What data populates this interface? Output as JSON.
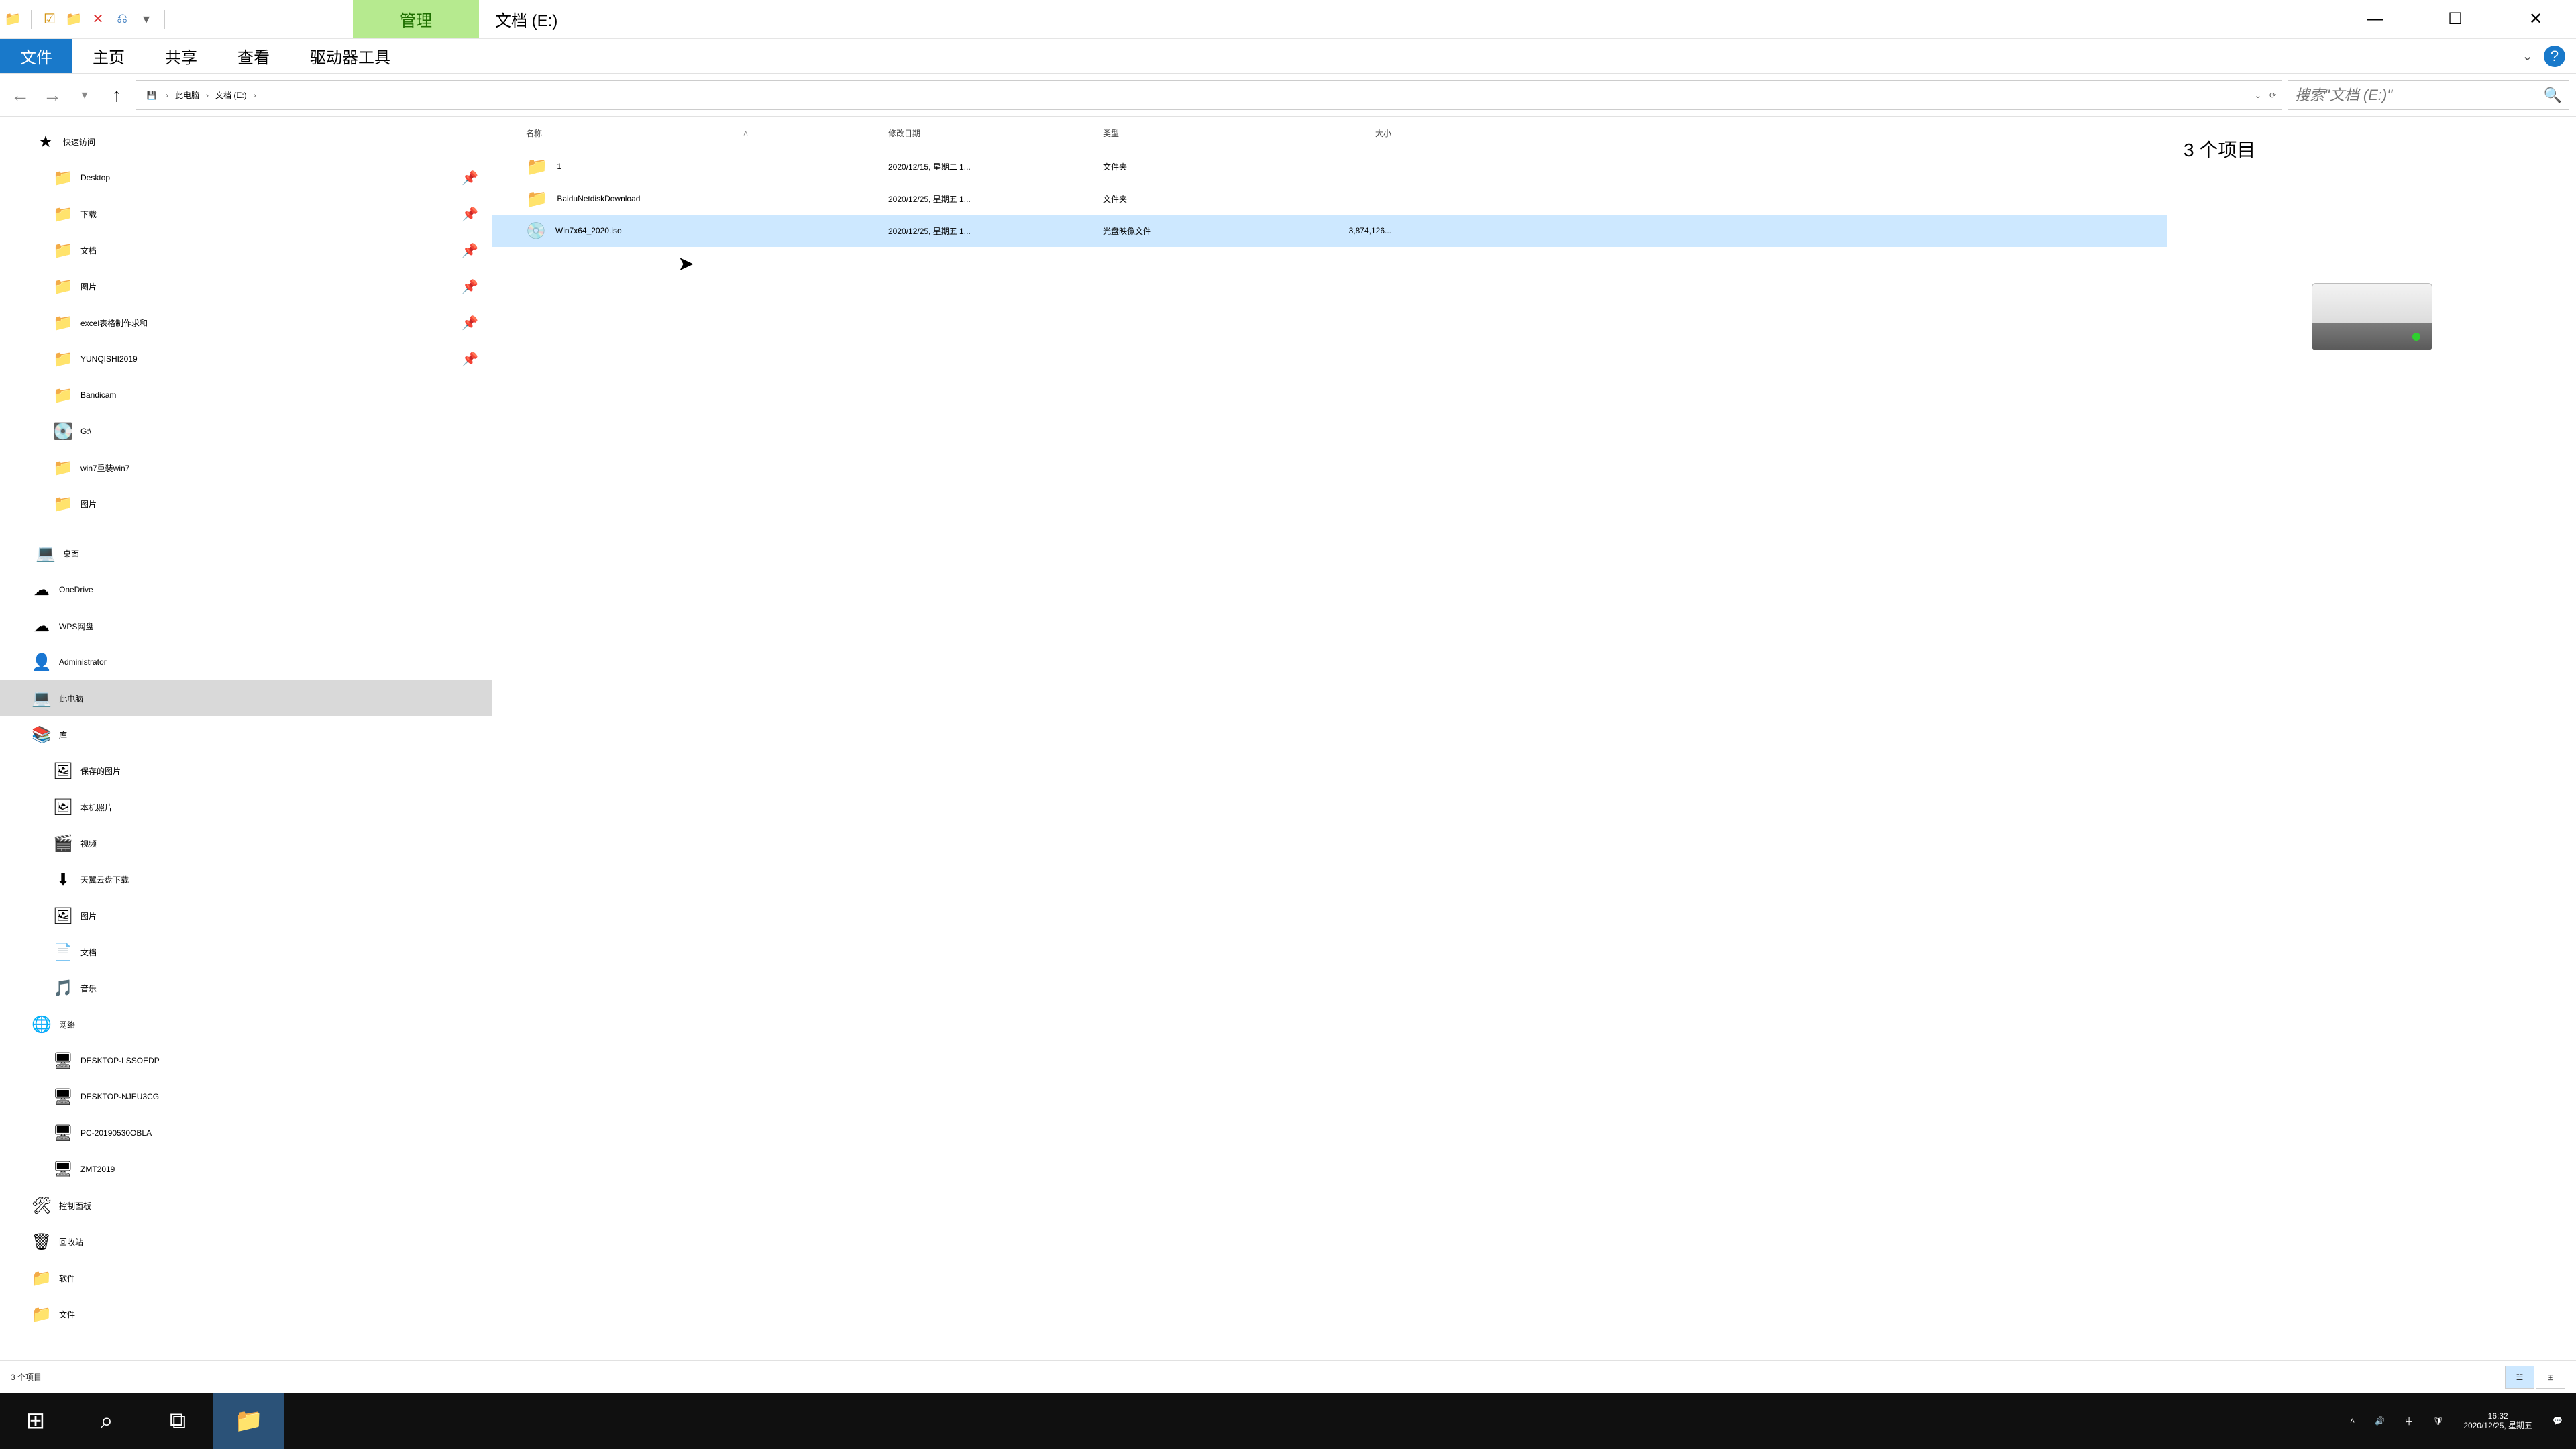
{
  "title_tab": "管理",
  "title_text": "文档 (E:)",
  "ribbon": {
    "file": "文件",
    "home": "主页",
    "share": "共享",
    "view": "查看",
    "drive": "驱动器工具"
  },
  "breadcrumb": [
    "此电脑",
    "文档 (E:)"
  ],
  "search_placeholder": "搜索\"文档 (E:)\"",
  "columns": {
    "name": "名称",
    "date": "修改日期",
    "type": "类型",
    "size": "大小"
  },
  "files": [
    {
      "name": "1",
      "date": "2020/12/15, 星期二 1...",
      "type": "文件夹",
      "size": "",
      "icon": "folder",
      "sel": false
    },
    {
      "name": "BaiduNetdiskDownload",
      "date": "2020/12/25, 星期五 1...",
      "type": "文件夹",
      "size": "",
      "icon": "folder",
      "sel": false
    },
    {
      "name": "Win7x64_2020.iso",
      "date": "2020/12/25, 星期五 1...",
      "type": "光盘映像文件",
      "size": "3,874,126...",
      "icon": "disc",
      "sel": true
    }
  ],
  "nav_quick": "快速访问",
  "nav_quick_items": [
    {
      "l": "Desktop",
      "i": "folder-blue",
      "pin": true
    },
    {
      "l": "下载",
      "i": "folder-blue",
      "pin": true
    },
    {
      "l": "文档",
      "i": "folder-blue",
      "pin": true
    },
    {
      "l": "图片",
      "i": "folder-blue",
      "pin": true
    },
    {
      "l": "excel表格制作求和",
      "i": "folder",
      "pin": true
    },
    {
      "l": "YUNQISHI2019",
      "i": "folder",
      "pin": true
    },
    {
      "l": "Bandicam",
      "i": "folder",
      "pin": false
    },
    {
      "l": "G:\\",
      "i": "drive",
      "pin": false
    },
    {
      "l": "win7重装win7",
      "i": "folder",
      "pin": false
    },
    {
      "l": "图片",
      "i": "folder",
      "pin": false
    }
  ],
  "nav_desktop": "桌面",
  "nav_desktop_items": [
    {
      "l": "OneDrive",
      "i": "cloud"
    },
    {
      "l": "WPS网盘",
      "i": "cloud"
    },
    {
      "l": "Administrator",
      "i": "user"
    },
    {
      "l": "此电脑",
      "i": "pc",
      "sel": true
    },
    {
      "l": "库",
      "i": "lib"
    },
    {
      "l": "保存的图片",
      "i": "pic",
      "ind": true
    },
    {
      "l": "本机照片",
      "i": "pic",
      "ind": true
    },
    {
      "l": "视频",
      "i": "vid",
      "ind": true
    },
    {
      "l": "天翼云盘下载",
      "i": "dl",
      "ind": true
    },
    {
      "l": "图片",
      "i": "pic",
      "ind": true
    },
    {
      "l": "文档",
      "i": "doc",
      "ind": true
    },
    {
      "l": "音乐",
      "i": "mus",
      "ind": true
    },
    {
      "l": "网络",
      "i": "net"
    },
    {
      "l": "DESKTOP-LSSOEDP",
      "i": "pc-net",
      "ind": true
    },
    {
      "l": "DESKTOP-NJEU3CG",
      "i": "pc-net",
      "ind": true
    },
    {
      "l": "PC-20190530OBLA",
      "i": "pc-net",
      "ind": true
    },
    {
      "l": "ZMT2019",
      "i": "pc-net",
      "ind": true
    },
    {
      "l": "控制面板",
      "i": "cp"
    },
    {
      "l": "回收站",
      "i": "bin"
    },
    {
      "l": "软件",
      "i": "folder"
    },
    {
      "l": "文件",
      "i": "folder"
    }
  ],
  "preview_count": "3 个项目",
  "status_text": "3 个项目",
  "tray": {
    "ime": "中",
    "time": "16:32",
    "date": "2020/12/25, 星期五"
  }
}
